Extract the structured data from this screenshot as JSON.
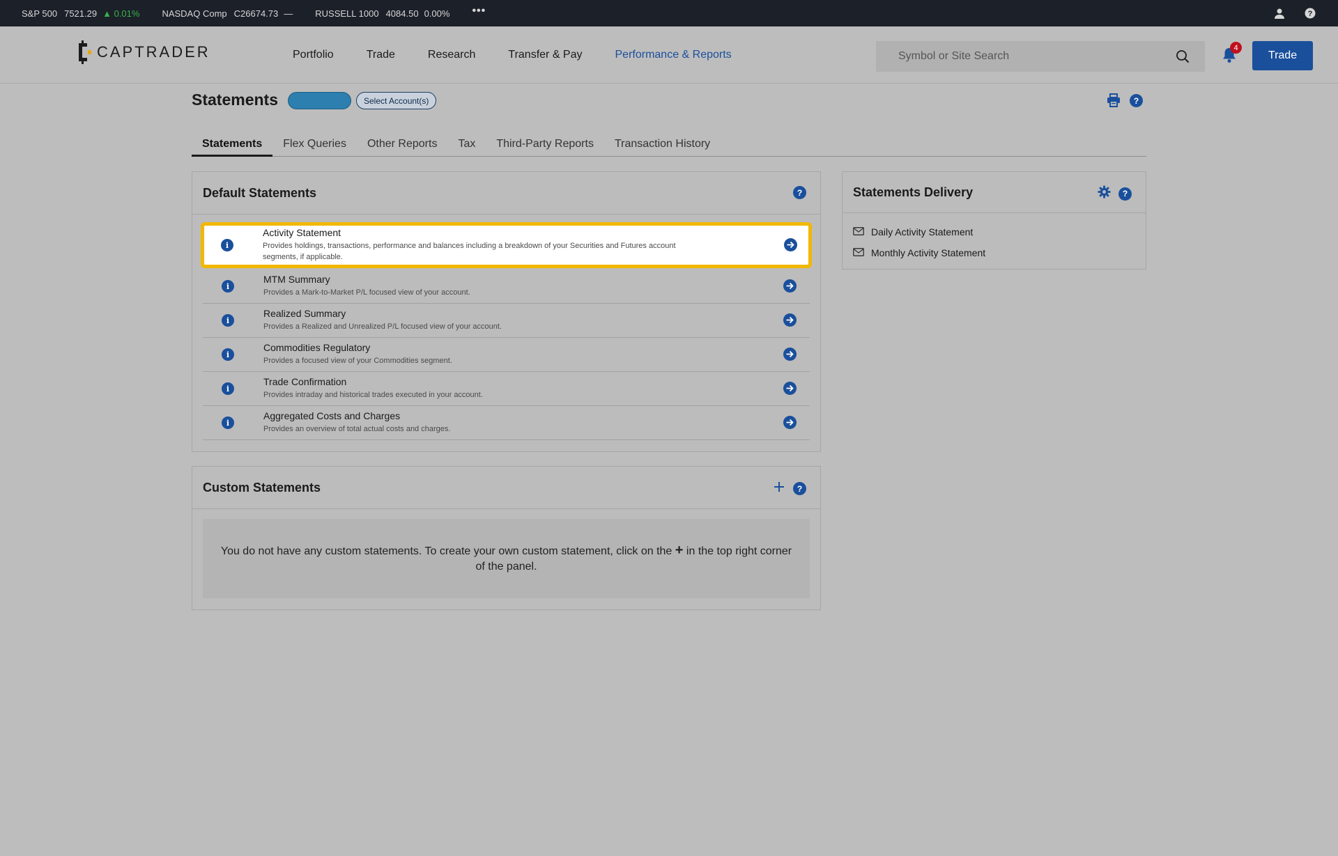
{
  "ticker": {
    "items": [
      {
        "name": "S&P 500",
        "value": "7521.29",
        "change": "▲ 0.01%"
      },
      {
        "name": "NASDAQ Comp",
        "value": "C26674.73",
        "change": "—"
      },
      {
        "name": "RUSSELL 1000",
        "value": "4084.50",
        "change": "0.00%"
      }
    ],
    "more": "•••"
  },
  "brand": {
    "name": "CAPTRADER"
  },
  "nav": {
    "items": [
      "Portfolio",
      "Trade",
      "Research",
      "Transfer & Pay",
      "Performance & Reports"
    ],
    "active": "Performance & Reports"
  },
  "search": {
    "placeholder": "Symbol or Site Search"
  },
  "notifications": {
    "count": "4"
  },
  "trade_button": "Trade",
  "page": {
    "title": "Statements",
    "select_accounts": "Select Account(s)",
    "help": "?"
  },
  "tabs": [
    "Statements",
    "Flex Queries",
    "Other Reports",
    "Tax",
    "Third-Party Reports",
    "Transaction History"
  ],
  "default_statements": {
    "title": "Default Statements",
    "items": [
      {
        "name": "Activity Statement",
        "desc": "Provides holdings, transactions, performance and balances including a breakdown of your Securities and Futures account segments, if applicable."
      },
      {
        "name": "MTM Summary",
        "desc": "Provides a Mark-to-Market P/L focused view of your account."
      },
      {
        "name": "Realized Summary",
        "desc": "Provides a Realized and Unrealized P/L focused view of your account."
      },
      {
        "name": "Commodities Regulatory",
        "desc": "Provides a focused view of your Commodities segment."
      },
      {
        "name": "Trade Confirmation",
        "desc": "Provides intraday and historical trades executed in your account."
      },
      {
        "name": "Aggregated Costs and Charges",
        "desc": "Provides an overview of total actual costs and charges."
      }
    ]
  },
  "custom_statements": {
    "title": "Custom Statements",
    "empty_pre": "You do not have any custom statements. To create your own custom statement, click on the",
    "empty_plus": "+",
    "empty_post": "in the top right corner of the panel."
  },
  "delivery": {
    "title": "Statements Delivery",
    "items": [
      "Daily Activity Statement",
      "Monthly Activity Statement"
    ]
  },
  "colors": {
    "accent": "#1a4f9c",
    "highlight": "#f2b800",
    "up": "#37b34a",
    "badge": "#c0101d"
  }
}
